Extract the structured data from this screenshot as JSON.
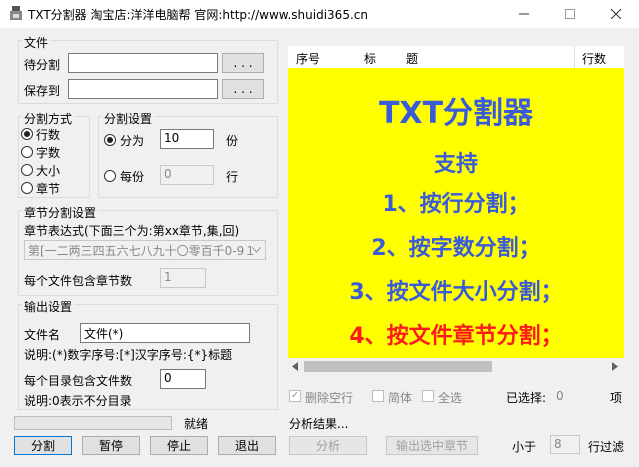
{
  "window": {
    "title": "TXT分割器 淘宝店:洋洋电脑帮 官网:http://www.shuidi365.cn",
    "minimize_icon": "minimize-icon",
    "maximize_icon": "maximize-icon",
    "close_icon": "close-icon"
  },
  "file_group": {
    "legend": "文件",
    "source_label": "待分割",
    "source_value": "",
    "save_label": "保存到",
    "save_value": "",
    "browse_label": ". . .",
    "browse_save_label": ". . ."
  },
  "split_mode": {
    "legend": "分割方式",
    "options": [
      "行数",
      "字数",
      "大小",
      "章节"
    ],
    "selected": "行数"
  },
  "split_settings": {
    "legend": "分割设置",
    "divide_label": "分为",
    "divide_value": "10",
    "divide_unit": "份",
    "each_label": "每份",
    "each_value": "0",
    "each_unit": "行",
    "selected": "分为"
  },
  "chapter_settings": {
    "legend": "章节分割设置",
    "expr_label": "章节表达式(下面三个为:第xx章节,集,回)",
    "expr_value": "第[一二两三四五六七八九十〇零百千0-9１",
    "chapters_per_file_label": "每个文件包含章节数",
    "chapters_per_file_value": "1"
  },
  "output_settings": {
    "legend": "输出设置",
    "filename_label": "文件名",
    "filename_value": "文件(*)",
    "filename_hint": "说明:(*)数字序号:[*]汉字序号:{*}标题",
    "files_per_dir_label": "每个目录包含文件数",
    "files_per_dir_value": "0",
    "files_per_dir_hint": "说明:0表示不分目录"
  },
  "list": {
    "columns": [
      "序号",
      "标",
      "题",
      "行数"
    ]
  },
  "promo": {
    "title": "TXT分割器",
    "subtitle": "支持",
    "lines": [
      "1、按行分割；",
      "2、按字数分割；",
      "3、按文件大小分割；",
      "4、按文件章节分割；"
    ],
    "colors": {
      "blue": "#3a5bd9",
      "red": "#ff1a1a",
      "bg": "#ffff00"
    }
  },
  "filters": {
    "remove_empty_label": "删除空行",
    "simplified_label": "简体",
    "select_all_label": "全选",
    "selected_label": "已选择:",
    "selected_count": "0",
    "selected_unit": "项"
  },
  "status": {
    "progress": 0,
    "ready_text": "就绪",
    "analysis_text": "分析结果..."
  },
  "buttons": {
    "split": "分割",
    "pause": "暂停",
    "stop": "停止",
    "exit": "退出",
    "analyze": "分析",
    "export_selected": "输出选中章节"
  },
  "filter_size": {
    "less_than_label": "小于",
    "value": "8",
    "filter_label": "行过滤"
  }
}
